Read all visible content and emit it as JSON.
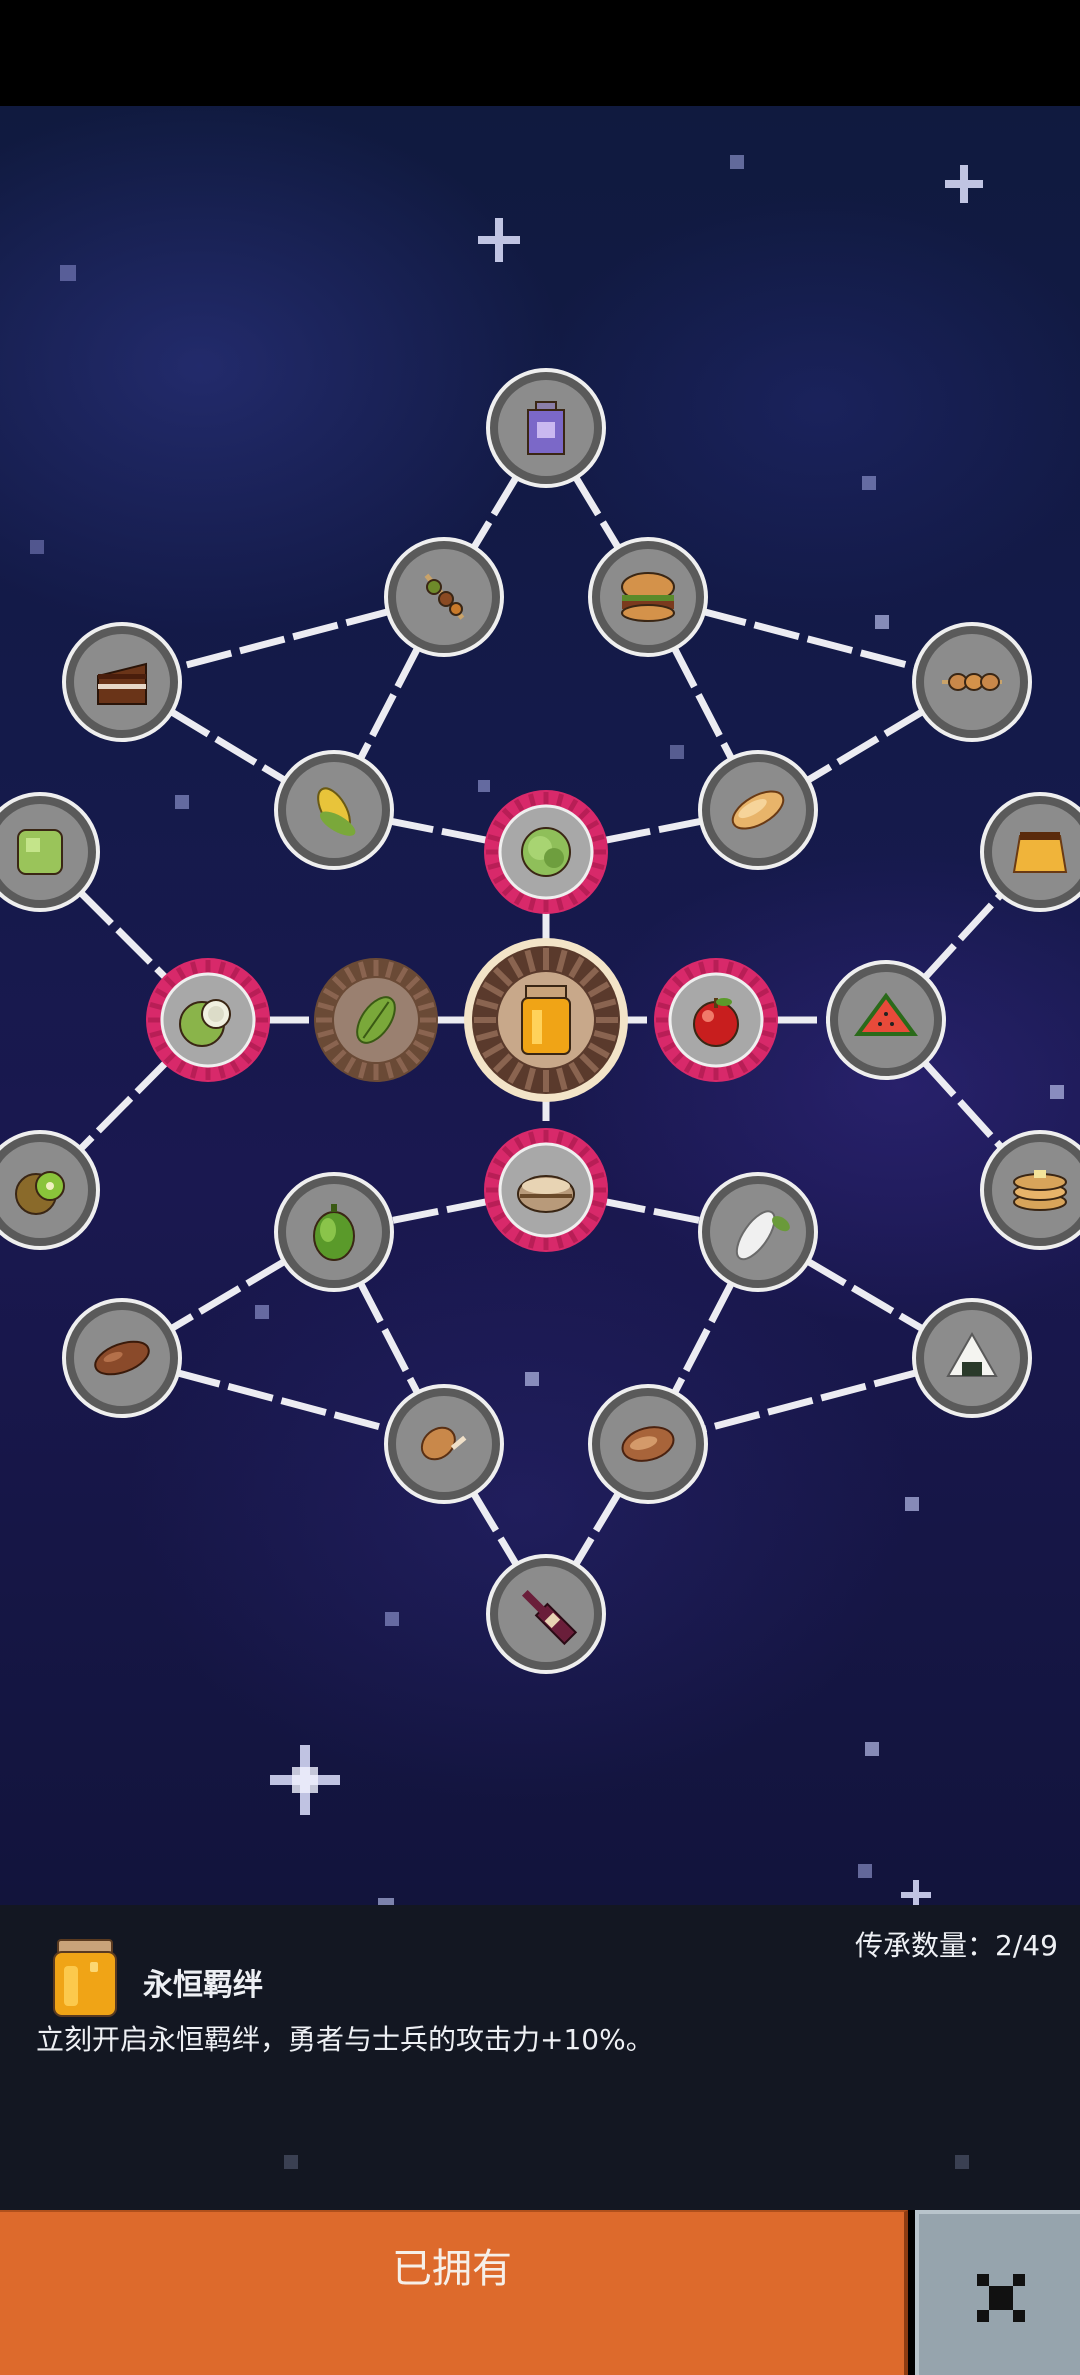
{
  "panel": {
    "title": "永恒羁绊",
    "description": "立刻开启永恒羁绊，勇者与士兵的攻击力+10%。",
    "count_text": "传承数量：2/49"
  },
  "buttons": {
    "owned_label": "已拥有",
    "close_icon": "close-icon"
  },
  "colors": {
    "sky": "#141a4a",
    "node_locked": "#7d7d7d",
    "node_unlocked": "#d8296a",
    "node_owned": "#6a4a36",
    "own_button": "#dd6a2c",
    "close_button": "#96a4ad",
    "panel_bg": "#131722"
  },
  "nodes": [
    {
      "id": "potion-jar",
      "icon": "purple-potion-icon",
      "state": "locked"
    },
    {
      "id": "kebab",
      "icon": "kebab-icon",
      "state": "locked"
    },
    {
      "id": "burger",
      "icon": "burger-icon",
      "state": "locked"
    },
    {
      "id": "cake",
      "icon": "cake-icon",
      "state": "locked"
    },
    {
      "id": "skewer",
      "icon": "skewer-icon",
      "state": "locked"
    },
    {
      "id": "corn",
      "icon": "corn-icon",
      "state": "locked"
    },
    {
      "id": "cabbage",
      "icon": "cabbage-icon",
      "state": "unlocked"
    },
    {
      "id": "bread",
      "icon": "bread-icon",
      "state": "locked"
    },
    {
      "id": "jelly",
      "icon": "green-jelly-icon",
      "state": "locked"
    },
    {
      "id": "pudding",
      "icon": "pudding-icon",
      "state": "locked"
    },
    {
      "id": "coconut",
      "icon": "coconut-icon",
      "state": "unlocked"
    },
    {
      "id": "leaf",
      "icon": "leaf-icon",
      "state": "owned"
    },
    {
      "id": "honey-jar",
      "icon": "honey-jar-icon",
      "state": "selected"
    },
    {
      "id": "apple",
      "icon": "apple-icon",
      "state": "unlocked"
    },
    {
      "id": "watermelon",
      "icon": "watermelon-icon",
      "state": "locked"
    },
    {
      "id": "kiwi",
      "icon": "kiwi-icon",
      "state": "locked"
    },
    {
      "id": "bowl",
      "icon": "bowl-icon",
      "state": "unlocked"
    },
    {
      "id": "pancakes",
      "icon": "pancakes-icon",
      "state": "locked"
    },
    {
      "id": "pepper",
      "icon": "green-pepper-icon",
      "state": "locked"
    },
    {
      "id": "radish",
      "icon": "radish-icon",
      "state": "locked"
    },
    {
      "id": "sausage",
      "icon": "sausage-icon",
      "state": "locked"
    },
    {
      "id": "onigiri",
      "icon": "onigiri-icon",
      "state": "locked"
    },
    {
      "id": "drumstick",
      "icon": "drumstick-icon",
      "state": "locked"
    },
    {
      "id": "steak",
      "icon": "steak-icon",
      "state": "locked"
    },
    {
      "id": "wine",
      "icon": "wine-bottle-icon",
      "state": "locked"
    }
  ],
  "edges": [
    [
      "potion-jar",
      "kebab"
    ],
    [
      "potion-jar",
      "burger"
    ],
    [
      "kebab",
      "cake"
    ],
    [
      "kebab",
      "corn"
    ],
    [
      "burger",
      "skewer"
    ],
    [
      "burger",
      "bread"
    ],
    [
      "cake",
      "corn"
    ],
    [
      "skewer",
      "bread"
    ],
    [
      "corn",
      "cabbage"
    ],
    [
      "bread",
      "cabbage"
    ],
    [
      "cabbage",
      "honey-jar"
    ],
    [
      "jelly",
      "coconut"
    ],
    [
      "coconut",
      "kiwi"
    ],
    [
      "coconut",
      "leaf"
    ],
    [
      "leaf",
      "honey-jar"
    ],
    [
      "honey-jar",
      "apple"
    ],
    [
      "apple",
      "watermelon"
    ],
    [
      "watermelon",
      "pudding"
    ],
    [
      "watermelon",
      "pancakes"
    ],
    [
      "honey-jar",
      "bowl"
    ],
    [
      "bowl",
      "pepper"
    ],
    [
      "bowl",
      "radish"
    ],
    [
      "pepper",
      "sausage"
    ],
    [
      "pepper",
      "drumstick"
    ],
    [
      "radish",
      "onigiri"
    ],
    [
      "radish",
      "steak"
    ],
    [
      "sausage",
      "drumstick"
    ],
    [
      "onigiri",
      "steak"
    ],
    [
      "drumstick",
      "wine"
    ],
    [
      "steak",
      "wine"
    ]
  ]
}
